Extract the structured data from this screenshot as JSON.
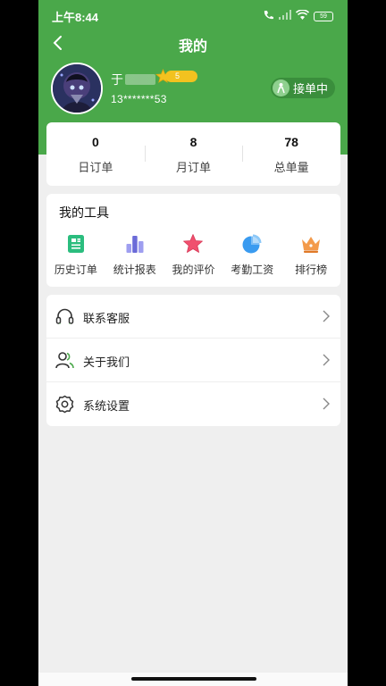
{
  "status_bar": {
    "time": "上午8:44",
    "battery": "59"
  },
  "nav": {
    "title": "我的"
  },
  "profile": {
    "name_prefix": "于",
    "level": "5",
    "phone": "13*******53",
    "work_status": "接单中"
  },
  "stats": [
    {
      "value": "0",
      "label": "日订单"
    },
    {
      "value": "8",
      "label": "月订单"
    },
    {
      "value": "78",
      "label": "总单量"
    }
  ],
  "tools": {
    "title": "我的工具",
    "items": [
      {
        "label": "历史订单",
        "icon": "order-history-icon",
        "color": "#2bbd7e"
      },
      {
        "label": "统计报表",
        "icon": "bar-chart-icon",
        "color": "#7b7bde"
      },
      {
        "label": "我的评价",
        "icon": "star-icon",
        "color": "#f0506e"
      },
      {
        "label": "考勤工资",
        "icon": "pie-chart-icon",
        "color": "#3a9bf0"
      },
      {
        "label": "排行榜",
        "icon": "crown-icon",
        "color": "#f39a4a"
      }
    ]
  },
  "menu": [
    {
      "label": "联系客服",
      "icon": "headset-icon"
    },
    {
      "label": "关于我们",
      "icon": "users-icon"
    },
    {
      "label": "系统设置",
      "icon": "settings-icon"
    }
  ],
  "colors": {
    "primary_green": "#4aa84a",
    "background": "#efefef"
  }
}
